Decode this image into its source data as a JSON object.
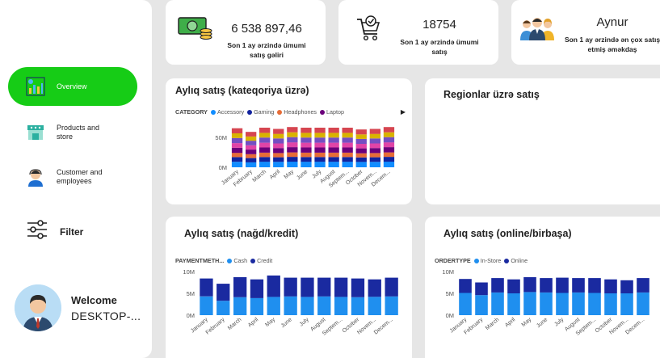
{
  "sidebar": {
    "items": [
      {
        "label": "Overview",
        "icon": "overview-chart-icon"
      },
      {
        "label": "Products and store",
        "icon": "store-icon"
      },
      {
        "label": "Customer and employees",
        "icon": "customer-service-icon"
      }
    ],
    "filter_label": "Filter",
    "welcome_title": "Welcome",
    "welcome_user": "DESKTOP-..."
  },
  "kpis": [
    {
      "value": "6 538 897,46",
      "label": "Son 1 ay ərzində ümumi satış gəliri",
      "icon": "money-icon"
    },
    {
      "value": "18754",
      "label": "Son 1 ay ərzində ümumi satış",
      "icon": "shopping-cart-icon"
    },
    {
      "value": "Aynur",
      "label": "Son 1 ay ərzində ən çox satış etmiş əməkdaş",
      "icon": "team-icon"
    }
  ],
  "colors": {
    "accent": "#16cc16",
    "cash": "#1f8fef",
    "credit": "#1a2aa0",
    "accessory": "#118dff",
    "gaming": "#12239e",
    "headphones": "#e66c37",
    "laptop": "#6b007b"
  },
  "panels": {
    "category": {
      "title": "Aylıq satış (kateqoriya üzrə)",
      "legend_title": "CATEGORY"
    },
    "regions": {
      "title": "Regionlar üzrə satış"
    },
    "payment": {
      "title": "Aylıq satış (nağd/kredit)",
      "legend_title": "PAYMENTMETH..."
    },
    "ordertype": {
      "title": "Aylıq satış (online/birbaşa)",
      "legend_title": "ORDERTYPE"
    }
  },
  "chart_data": [
    {
      "type": "bar",
      "stacked": true,
      "title": "Aylıq satış (kateqoriya üzrə)",
      "categories": [
        "January",
        "February",
        "March",
        "April",
        "May",
        "June",
        "July",
        "August",
        "Septem...",
        "October",
        "Novem...",
        "Decem..."
      ],
      "legend": [
        "Accessory",
        "Gaming",
        "Headphones",
        "Laptop"
      ],
      "y_ticks": [
        "0M",
        "50M"
      ],
      "ylim": [
        0,
        70
      ],
      "totals": [
        65,
        59,
        66,
        64,
        67,
        66,
        66,
        66,
        66,
        63,
        64,
        67
      ]
    },
    {
      "type": "bar",
      "stacked": true,
      "title": "Aylıq satış (nağd/kredit)",
      "categories": [
        "January",
        "February",
        "March",
        "April",
        "May",
        "June",
        "July",
        "August",
        "Septem...",
        "October",
        "Novem...",
        "Decem..."
      ],
      "y_ticks": [
        "0M",
        "5M",
        "10M"
      ],
      "ylim": [
        0,
        10
      ],
      "series": [
        {
          "name": "Cash",
          "values": [
            4.3,
            3.3,
            4.1,
            3.9,
            4.2,
            4.3,
            4.2,
            4.3,
            4.2,
            4.1,
            4.2,
            4.3
          ]
        },
        {
          "name": "Credit",
          "values": [
            4.1,
            3.9,
            4.6,
            4.3,
            4.9,
            4.3,
            4.4,
            4.3,
            4.4,
            4.3,
            4.0,
            4.3
          ]
        }
      ]
    },
    {
      "type": "bar",
      "stacked": true,
      "title": "Aylıq satış (online/birbaşa)",
      "categories": [
        "January",
        "February",
        "March",
        "April",
        "May",
        "June",
        "July",
        "August",
        "Septem...",
        "October",
        "Novem...",
        "Decem..."
      ],
      "y_ticks": [
        "0M",
        "5M",
        "10M"
      ],
      "ylim": [
        0,
        10
      ],
      "series": [
        {
          "name": "In-Store",
          "values": [
            5.1,
            4.6,
            5.2,
            5.0,
            5.3,
            5.2,
            5.1,
            5.2,
            5.1,
            5.0,
            5.0,
            5.2
          ]
        },
        {
          "name": "Online",
          "values": [
            3.2,
            2.9,
            3.3,
            3.2,
            3.4,
            3.3,
            3.5,
            3.3,
            3.4,
            3.2,
            3.0,
            3.3
          ]
        }
      ]
    }
  ]
}
